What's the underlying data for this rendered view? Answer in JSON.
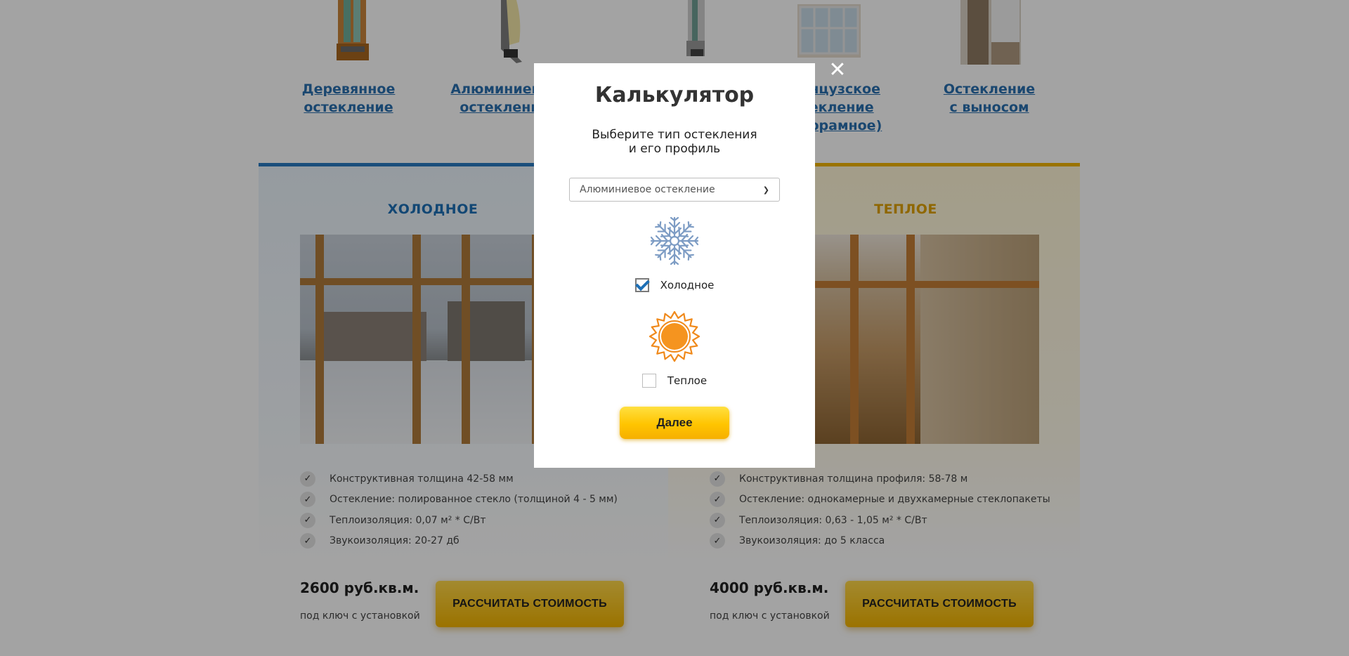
{
  "glazing_types": [
    {
      "label_line1": "Деревянное",
      "label_line2": "остекление",
      "icon": "wood-window-profile-icon"
    },
    {
      "label_line1": "Алюминиевое",
      "label_line2": "остекление",
      "icon": "aluminium-window-profile-icon"
    },
    {
      "label_line1": "",
      "label_line2": "",
      "icon": "pvc-window-profile-icon"
    },
    {
      "label_line1": "Французское",
      "label_line2": "остекление",
      "label_line3": "(панорамное)",
      "icon": "french-glazing-icon"
    },
    {
      "label_line1": "Остекление",
      "label_line2": "с выносом",
      "icon": "balcony-extension-icon"
    }
  ],
  "cold_panel": {
    "title": "ХОЛОДНОЕ",
    "features": [
      "Конструктивная толщина 42-58 мм",
      "Остекление: полированное стекло (толщиной 4 - 5 мм)",
      "Теплоизоляция: 0,07 м² * С/Вт",
      "Звукоизоляция: 20-27 дб"
    ],
    "price": "2600 руб.кв.м.",
    "price_note": "под ключ с установкой",
    "button": "РАССЧИТАТЬ СТОИМОСТЬ",
    "accent_color": "#2a7bc0"
  },
  "warm_panel": {
    "title": "ТЕПЛОЕ",
    "features": [
      "Конструктивная толщина профиля: 58-78 м",
      "Остекление: однокамерные и двухкамерные стеклопакеты",
      "Теплоизоляция: 0,63 - 1,05 м² * С/Вт",
      "Звукоизоляция: до 5 класса"
    ],
    "price": "4000 руб.кв.м.",
    "price_note": "под ключ с установкой",
    "button": "РАССЧИТАТЬ СТОИМОСТЬ",
    "accent_color": "#f1b400"
  },
  "modal": {
    "title": "Калькулятор",
    "subtitle_line1": "Выберите тип остекления",
    "subtitle_line2": "и его профиль",
    "select_value": "Алюминиевое остекление",
    "options": [
      {
        "label": "Холодное",
        "checked": true,
        "icon": "snowflake-icon"
      },
      {
        "label": "Теплое",
        "checked": false,
        "icon": "sun-icon"
      }
    ],
    "next_button": "Далее",
    "close_icon": "close-icon"
  }
}
